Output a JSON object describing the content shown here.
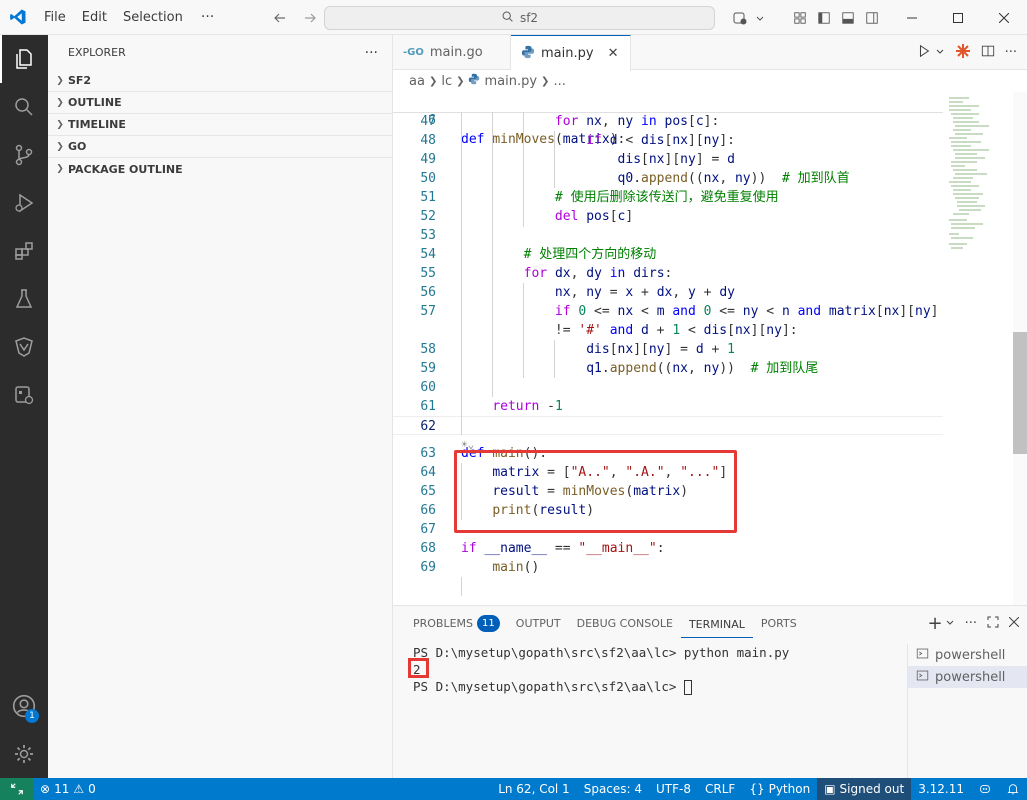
{
  "titlebar": {
    "menu": [
      "File",
      "Edit",
      "Selection"
    ],
    "more": "···",
    "search": "sf2"
  },
  "activitybar": {
    "icons": [
      "explorer-icon",
      "search-icon",
      "source-control-icon",
      "run-debug-icon",
      "extensions-icon",
      "testing-icon",
      "remote-explorer-icon",
      "docker-icon"
    ],
    "account_badge": "1"
  },
  "sidebar": {
    "title": "EXPLORER",
    "more": "···",
    "sections": [
      "SF2",
      "OUTLINE",
      "TIMELINE",
      "GO",
      "PACKAGE OUTLINE"
    ]
  },
  "editor": {
    "tabs": [
      {
        "label": "main.go",
        "icon": "go-file-icon",
        "active": false
      },
      {
        "label": "main.py",
        "icon": "python-file-icon",
        "active": true
      }
    ],
    "close": "✕",
    "breadcrumbs": [
      "aa",
      "lc",
      "main.py",
      "..."
    ],
    "sticky": {
      "num": "6",
      "text": "def minMoves(matrix):"
    },
    "lines": [
      {
        "num": "47",
        "text": "            for nx, ny in pos[c]:"
      },
      {
        "num": "48",
        "text": "                if d < dis[nx][ny]:"
      },
      {
        "num": "49",
        "text": "                    dis[nx][ny] = d"
      },
      {
        "num": "50",
        "text": "                    q0.append((nx, ny))  # 加到队首"
      },
      {
        "num": "51",
        "text": "            # 使用后删除该传送门，避免重复使用"
      },
      {
        "num": "52",
        "text": "            del pos[c]"
      },
      {
        "num": "53",
        "text": ""
      },
      {
        "num": "54",
        "text": "        # 处理四个方向的移动"
      },
      {
        "num": "55",
        "text": "        for dx, dy in dirs:"
      },
      {
        "num": "56",
        "text": "            nx, ny = x + dx, y + dy"
      },
      {
        "num": "57",
        "text": "            if 0 <= nx < m and 0 <= ny < n and matrix[nx][ny]"
      },
      {
        "num": "",
        "text": "            != '#' and d + 1 < dis[nx][ny]:"
      },
      {
        "num": "58",
        "text": "                dis[nx][ny] = d + 1"
      },
      {
        "num": "59",
        "text": "                q1.append((nx, ny))  # 加到队尾"
      },
      {
        "num": "60",
        "text": ""
      },
      {
        "num": "61",
        "text": "    return -1"
      },
      {
        "num": "62",
        "text": ""
      },
      {
        "num": "",
        "text": ""
      },
      {
        "num": "63",
        "text": "def main():"
      },
      {
        "num": "64",
        "text": "    matrix = [\"A..\", \".A.\", \"...\"]"
      },
      {
        "num": "65",
        "text": "    result = minMoves(matrix)"
      },
      {
        "num": "66",
        "text": "    print(result)"
      },
      {
        "num": "67",
        "text": ""
      },
      {
        "num": "68",
        "text": "if __name__ == \"__main__\":"
      },
      {
        "num": "69",
        "text": "    main()"
      }
    ]
  },
  "panel": {
    "tabs": [
      {
        "label": "PROBLEMS",
        "badge": "11"
      },
      {
        "label": "OUTPUT"
      },
      {
        "label": "DEBUG CONSOLE"
      },
      {
        "label": "TERMINAL",
        "active": true
      },
      {
        "label": "PORTS"
      }
    ],
    "add": "+",
    "terminal_lines": [
      "PS D:\\mysetup\\gopath\\src\\sf2\\aa\\lc> python main.py",
      "2",
      "PS D:\\mysetup\\gopath\\src\\sf2\\aa\\lc> "
    ],
    "terminals": [
      "powershell",
      "powershell"
    ]
  },
  "statusbar": {
    "errors": "11",
    "warnings": "0",
    "position": "Ln 62, Col 1",
    "spaces": "Spaces: 4",
    "encoding": "UTF-8",
    "eol": "CRLF",
    "language": "Python",
    "signed_out": "Signed out",
    "python_version": "3.12.11"
  }
}
